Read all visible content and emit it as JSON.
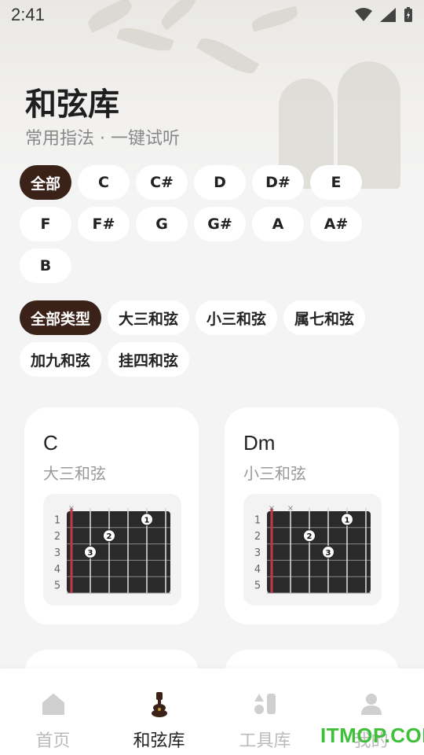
{
  "status": {
    "time": "2:41"
  },
  "header": {
    "title": "和弦库",
    "subtitle": "常用指法 · 一键试听"
  },
  "root_filters": [
    "全部",
    "C",
    "C#",
    "D",
    "D#",
    "E",
    "F",
    "F#",
    "G",
    "G#",
    "A",
    "A#",
    "B"
  ],
  "type_filters": [
    "全部类型",
    "大三和弦",
    "小三和弦",
    "属七和弦",
    "加九和弦",
    "挂四和弦"
  ],
  "cards": [
    {
      "name": "C",
      "type": "大三和弦",
      "muted": [
        1
      ],
      "fingers": [
        {
          "n": "1",
          "string": 5,
          "fret": 1
        },
        {
          "n": "2",
          "string": 3,
          "fret": 2
        },
        {
          "n": "3",
          "string": 2,
          "fret": 3
        }
      ]
    },
    {
      "name": "Dm",
      "type": "小三和弦",
      "muted": [
        1,
        2
      ],
      "fingers": [
        {
          "n": "1",
          "string": 5,
          "fret": 1
        },
        {
          "n": "2",
          "string": 3,
          "fret": 2
        },
        {
          "n": "3",
          "string": 4,
          "fret": 3
        }
      ]
    }
  ],
  "fret_numbers": [
    "1",
    "2",
    "3",
    "4",
    "5"
  ],
  "nav": [
    "首页",
    "和弦库",
    "工具库",
    "我的"
  ],
  "watermark": "ITMOP.COM",
  "colors": {
    "accent": "#3b2218",
    "fretboard": "#2a2a2a",
    "nut": "#c0394a"
  }
}
